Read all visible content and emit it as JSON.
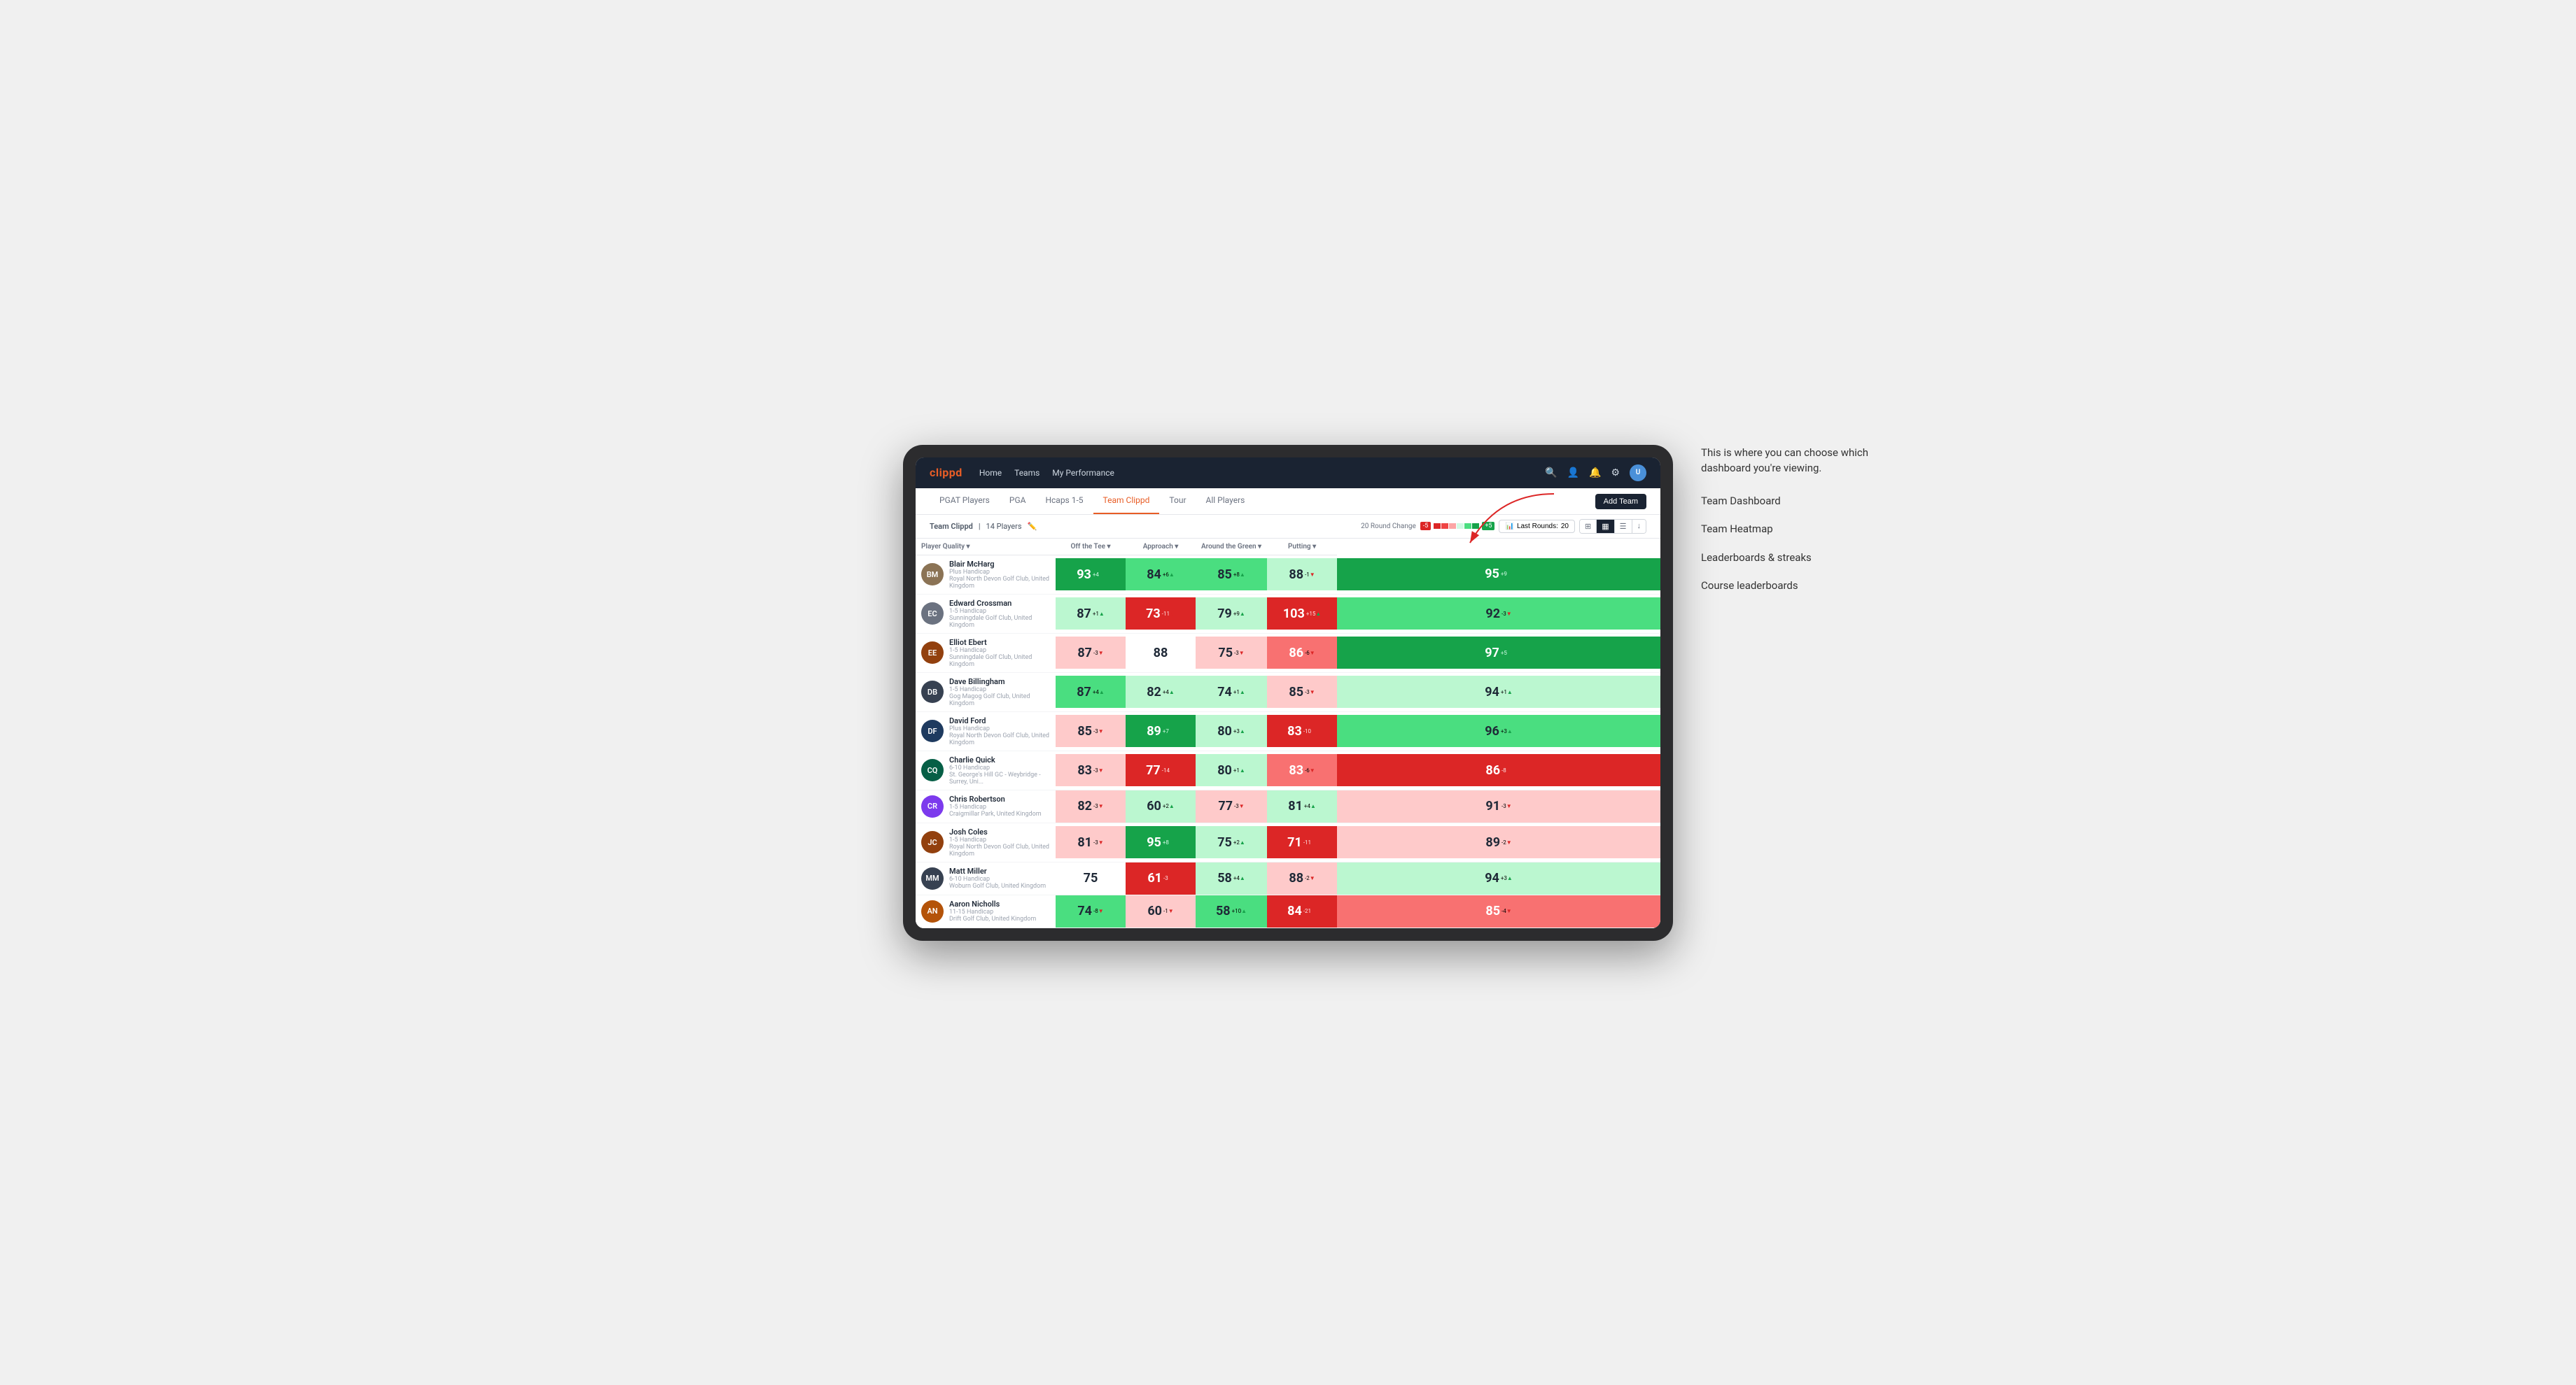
{
  "annotation": {
    "intro": "This is where you can choose which dashboard you're viewing.",
    "items": [
      "Team Dashboard",
      "Team Heatmap",
      "Leaderboards & streaks",
      "Course leaderboards"
    ]
  },
  "nav": {
    "brand": "clippd",
    "links": [
      "Home",
      "Teams",
      "My Performance"
    ],
    "icons": [
      "search",
      "user",
      "bell",
      "settings",
      "user-circle"
    ]
  },
  "sub_nav": {
    "tabs": [
      "PGAT Players",
      "PGA",
      "Hcaps 1-5",
      "Team Clippd",
      "Tour",
      "All Players"
    ],
    "active": "Team Clippd",
    "add_team_label": "Add Team"
  },
  "team_bar": {
    "name": "Team Clippd",
    "player_count": "14 Players",
    "round_change_label": "20 Round Change",
    "neg_value": "-5",
    "pos_value": "+5",
    "last_rounds_label": "Last Rounds:",
    "last_rounds_value": "20",
    "view_options": [
      "grid",
      "heatmap",
      "list",
      "download"
    ]
  },
  "table": {
    "columns": [
      {
        "id": "player",
        "label": "Player Quality ▾"
      },
      {
        "id": "off_tee",
        "label": "Off the Tee ▾"
      },
      {
        "id": "approach",
        "label": "Approach ▾"
      },
      {
        "id": "around_green",
        "label": "Around the Green ▾"
      },
      {
        "id": "putting",
        "label": "Putting ▾"
      }
    ],
    "players": [
      {
        "name": "Blair McHarg",
        "handicap": "Plus Handicap",
        "club": "Royal North Devon Golf Club, United Kingdom",
        "initials": "BM",
        "avatar_color": "#8b7355",
        "stats": {
          "player_quality": {
            "value": 93,
            "change": "+4",
            "dir": "up",
            "heat": "green-strong"
          },
          "off_tee": {
            "value": 84,
            "change": "+6",
            "dir": "up",
            "heat": "green-medium"
          },
          "approach": {
            "value": 85,
            "change": "+8",
            "dir": "up",
            "heat": "green-medium"
          },
          "around_green": {
            "value": 88,
            "change": "-1",
            "dir": "down",
            "heat": "green-light"
          },
          "putting": {
            "value": 95,
            "change": "+9",
            "dir": "up",
            "heat": "green-strong"
          }
        }
      },
      {
        "name": "Edward Crossman",
        "handicap": "1-5 Handicap",
        "club": "Sunningdale Golf Club, United Kingdom",
        "initials": "EC",
        "avatar_color": "#6b7280",
        "stats": {
          "player_quality": {
            "value": 87,
            "change": "+1",
            "dir": "up",
            "heat": "green-light"
          },
          "off_tee": {
            "value": 73,
            "change": "-11",
            "dir": "down",
            "heat": "red-strong"
          },
          "approach": {
            "value": 79,
            "change": "+9",
            "dir": "up",
            "heat": "green-light"
          },
          "around_green": {
            "value": 103,
            "change": "+15",
            "dir": "up",
            "heat": "red-strong"
          },
          "putting": {
            "value": 92,
            "change": "-3",
            "dir": "down",
            "heat": "green-medium"
          }
        }
      },
      {
        "name": "Elliot Ebert",
        "handicap": "1-5 Handicap",
        "club": "Sunningdale Golf Club, United Kingdom",
        "initials": "EE",
        "avatar_color": "#92400e",
        "stats": {
          "player_quality": {
            "value": 87,
            "change": "-3",
            "dir": "down",
            "heat": "red-light"
          },
          "off_tee": {
            "value": 88,
            "change": "",
            "dir": "none",
            "heat": "neutral"
          },
          "approach": {
            "value": 75,
            "change": "-3",
            "dir": "down",
            "heat": "red-light"
          },
          "around_green": {
            "value": 86,
            "change": "-6",
            "dir": "down",
            "heat": "red-medium"
          },
          "putting": {
            "value": 97,
            "change": "+5",
            "dir": "up",
            "heat": "green-strong"
          }
        }
      },
      {
        "name": "Dave Billingham",
        "handicap": "1-5 Handicap",
        "club": "Gog Magog Golf Club, United Kingdom",
        "initials": "DB",
        "avatar_color": "#374151",
        "stats": {
          "player_quality": {
            "value": 87,
            "change": "+4",
            "dir": "up",
            "heat": "green-medium"
          },
          "off_tee": {
            "value": 82,
            "change": "+4",
            "dir": "up",
            "heat": "green-light"
          },
          "approach": {
            "value": 74,
            "change": "+1",
            "dir": "up",
            "heat": "green-light"
          },
          "around_green": {
            "value": 85,
            "change": "-3",
            "dir": "down",
            "heat": "red-light"
          },
          "putting": {
            "value": 94,
            "change": "+1",
            "dir": "up",
            "heat": "green-light"
          }
        }
      },
      {
        "name": "David Ford",
        "handicap": "Plus Handicap",
        "club": "Royal North Devon Golf Club, United Kingdom",
        "initials": "DF",
        "avatar_color": "#1e3a5f",
        "stats": {
          "player_quality": {
            "value": 85,
            "change": "-3",
            "dir": "down",
            "heat": "red-light"
          },
          "off_tee": {
            "value": 89,
            "change": "+7",
            "dir": "up",
            "heat": "green-strong"
          },
          "approach": {
            "value": 80,
            "change": "+3",
            "dir": "up",
            "heat": "green-light"
          },
          "around_green": {
            "value": 83,
            "change": "-10",
            "dir": "down",
            "heat": "red-strong"
          },
          "putting": {
            "value": 96,
            "change": "+3",
            "dir": "up",
            "heat": "green-medium"
          }
        }
      },
      {
        "name": "Charlie Quick",
        "handicap": "6-10 Handicap",
        "club": "St. George's Hill GC - Weybridge - Surrey, Uni...",
        "initials": "CQ",
        "avatar_color": "#065f46",
        "stats": {
          "player_quality": {
            "value": 83,
            "change": "-3",
            "dir": "down",
            "heat": "red-light"
          },
          "off_tee": {
            "value": 77,
            "change": "-14",
            "dir": "down",
            "heat": "red-strong"
          },
          "approach": {
            "value": 80,
            "change": "+1",
            "dir": "up",
            "heat": "green-light"
          },
          "around_green": {
            "value": 83,
            "change": "-6",
            "dir": "down",
            "heat": "red-medium"
          },
          "putting": {
            "value": 86,
            "change": "-8",
            "dir": "down",
            "heat": "red-strong"
          }
        }
      },
      {
        "name": "Chris Robertson",
        "handicap": "1-5 Handicap",
        "club": "Craigmillar Park, United Kingdom",
        "initials": "CR",
        "avatar_color": "#7c3aed",
        "stats": {
          "player_quality": {
            "value": 82,
            "change": "-3",
            "dir": "down",
            "heat": "red-light"
          },
          "off_tee": {
            "value": 60,
            "change": "+2",
            "dir": "up",
            "heat": "green-light"
          },
          "approach": {
            "value": 77,
            "change": "-3",
            "dir": "down",
            "heat": "red-light"
          },
          "around_green": {
            "value": 81,
            "change": "+4",
            "dir": "up",
            "heat": "green-light"
          },
          "putting": {
            "value": 91,
            "change": "-3",
            "dir": "down",
            "heat": "red-light"
          }
        }
      },
      {
        "name": "Josh Coles",
        "handicap": "1-5 Handicap",
        "club": "Royal North Devon Golf Club, United Kingdom",
        "initials": "JC",
        "avatar_color": "#92400e",
        "stats": {
          "player_quality": {
            "value": 81,
            "change": "-3",
            "dir": "down",
            "heat": "red-light"
          },
          "off_tee": {
            "value": 95,
            "change": "+8",
            "dir": "up",
            "heat": "green-strong"
          },
          "approach": {
            "value": 75,
            "change": "+2",
            "dir": "up",
            "heat": "green-light"
          },
          "around_green": {
            "value": 71,
            "change": "-11",
            "dir": "down",
            "heat": "red-strong"
          },
          "putting": {
            "value": 89,
            "change": "-2",
            "dir": "down",
            "heat": "red-light"
          }
        }
      },
      {
        "name": "Matt Miller",
        "handicap": "6-10 Handicap",
        "club": "Woburn Golf Club, United Kingdom",
        "initials": "MM",
        "avatar_color": "#374151",
        "stats": {
          "player_quality": {
            "value": 75,
            "change": "",
            "dir": "none",
            "heat": "neutral"
          },
          "off_tee": {
            "value": 61,
            "change": "-3",
            "dir": "down",
            "heat": "red-strong"
          },
          "approach": {
            "value": 58,
            "change": "+4",
            "dir": "up",
            "heat": "green-light"
          },
          "around_green": {
            "value": 88,
            "change": "-2",
            "dir": "down",
            "heat": "red-light"
          },
          "putting": {
            "value": 94,
            "change": "+3",
            "dir": "up",
            "heat": "green-light"
          }
        }
      },
      {
        "name": "Aaron Nicholls",
        "handicap": "11-15 Handicap",
        "club": "Drift Golf Club, United Kingdom",
        "initials": "AN",
        "avatar_color": "#b45309",
        "stats": {
          "player_quality": {
            "value": 74,
            "change": "-8",
            "dir": "down",
            "heat": "green-medium"
          },
          "off_tee": {
            "value": 60,
            "change": "-1",
            "dir": "down",
            "heat": "red-light"
          },
          "approach": {
            "value": 58,
            "change": "+10",
            "dir": "up",
            "heat": "green-medium"
          },
          "around_green": {
            "value": 84,
            "change": "-21",
            "dir": "down",
            "heat": "red-strong"
          },
          "putting": {
            "value": 85,
            "change": "-4",
            "dir": "down",
            "heat": "red-medium"
          }
        }
      }
    ]
  }
}
